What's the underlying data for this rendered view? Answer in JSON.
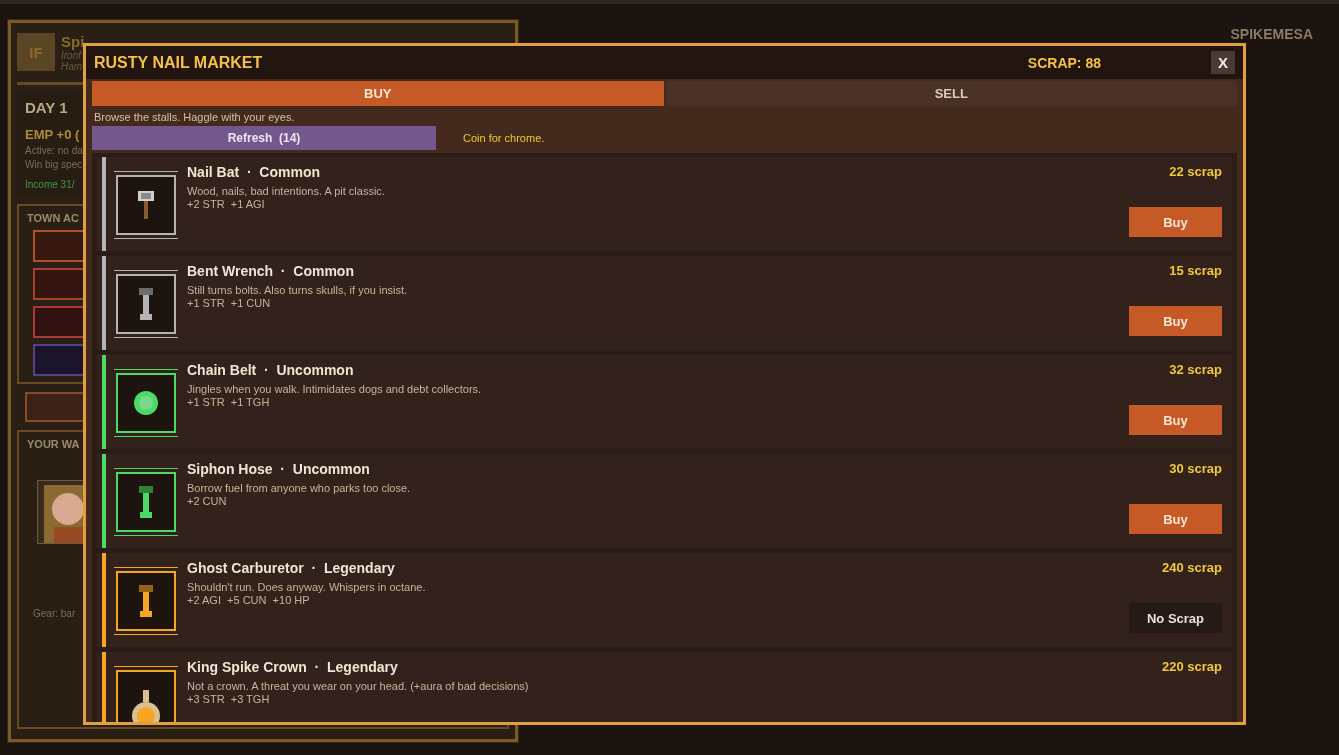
{
  "background": {
    "badge": "IF",
    "owner": "Spi",
    "owner_sub": [
      "Ironf",
      "Ham"
    ],
    "day": "DAY 1",
    "emp": "EMP +0  (",
    "active": [
      "Active: no da",
      "Win big spec"
    ],
    "income": "Income 31/",
    "town_actions": {
      "title": "TOWN AC",
      "buttons": [
        {
          "color": "#b2502e"
        },
        {
          "color": "#a8402e"
        },
        {
          "color": "#a83a3a"
        },
        {
          "color": "#5a3f8a"
        }
      ]
    },
    "wagon": {
      "title": "YOUR WA",
      "gear": "Gear: bar"
    },
    "town_name": "SPIKEMESA"
  },
  "market": {
    "title": "RUSTY NAIL MARKET",
    "scrap": "SCRAP: 88",
    "close": "X",
    "tabs": [
      {
        "label": "BUY",
        "selected": true
      },
      {
        "label": "SELL",
        "selected": false
      }
    ],
    "hint": "Browse the stalls. Haggle with your eyes.",
    "refresh": "Refresh  (14)",
    "flavor": "Coin for chrome.",
    "items": [
      {
        "name": "Nail Bat",
        "separator": "·",
        "rarity": "Common",
        "color": "#b4b4b4",
        "kind": "hammer",
        "description": "Wood, nails, bad intentions. A pit classic.",
        "stats": "+2 STR  +1 AGI",
        "price": "22 scrap",
        "button": {
          "label": "Buy",
          "kind": "buy"
        }
      },
      {
        "name": "Bent Wrench",
        "separator": "·",
        "rarity": "Common",
        "color": "#b4b4b4",
        "kind": "bar",
        "description": "Still turns bolts. Also turns skulls, if you insist.",
        "stats": "+1 STR  +1 CUN",
        "price": "15 scrap",
        "button": {
          "label": "Buy",
          "kind": "buy"
        }
      },
      {
        "name": "Chain Belt",
        "separator": "·",
        "rarity": "Uncommon",
        "color": "#4cd964",
        "kind": "orb",
        "description": "Jingles when you walk. Intimidates dogs and debt collectors.",
        "stats": "+1 STR  +1 TGH",
        "price": "32 scrap",
        "button": {
          "label": "Buy",
          "kind": "buy"
        }
      },
      {
        "name": "Siphon Hose",
        "separator": "·",
        "rarity": "Uncommon",
        "color": "#4cd964",
        "kind": "bar",
        "description": "Borrow fuel from anyone who parks too close.",
        "stats": "+2 CUN",
        "price": "30 scrap",
        "button": {
          "label": "Buy",
          "kind": "buy"
        }
      },
      {
        "name": "Ghost Carburetor",
        "separator": "·",
        "rarity": "Legendary",
        "color": "#f5a623",
        "kind": "bar",
        "description": "Shouldn't run. Does anyway. Whispers in octane.",
        "stats": "+2 AGI  +5 CUN  +10 HP",
        "price": "240 scrap",
        "button": {
          "label": "No Scrap",
          "kind": "disabled"
        }
      },
      {
        "name": "King Spike Crown",
        "separator": "·",
        "rarity": "Legendary",
        "color": "#f5a623",
        "kind": "pendant",
        "description": "Not a crown. A threat you wear on your head. (+aura of bad decisions)",
        "stats": "+3 STR  +3 TGH",
        "price": "220 scrap"
      }
    ]
  }
}
